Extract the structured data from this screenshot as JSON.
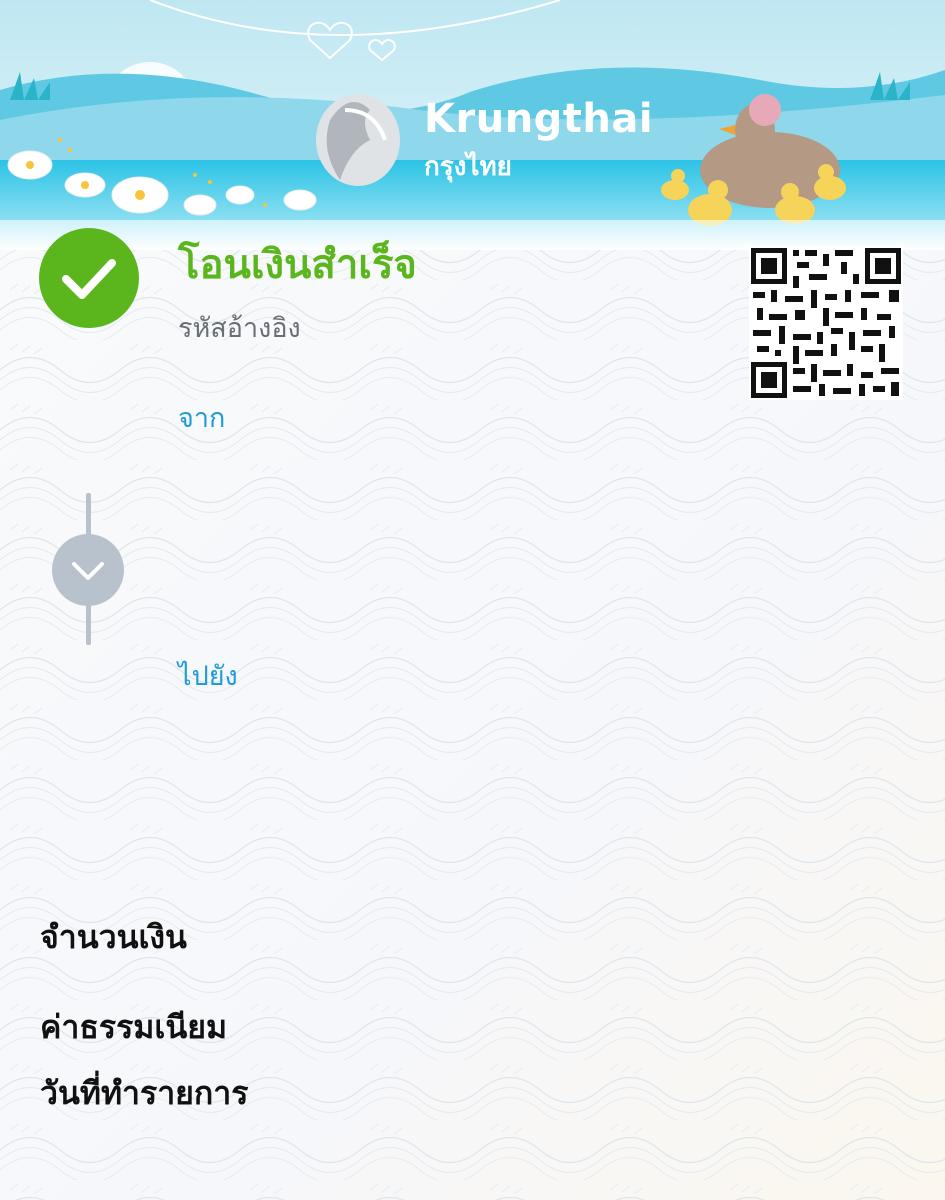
{
  "brand": {
    "name_en": "Krungthai",
    "name_th": "กรุงไทย"
  },
  "status": {
    "title": "โอนเงินสำเร็จ",
    "reference_label": "รหัสอ้างอิง"
  },
  "transfer": {
    "from_label": "จาก",
    "to_label": "ไปยัง"
  },
  "details": {
    "amount_label": "จำนวนเงิน",
    "fee_label": "ค่าธรรมเนียม",
    "date_label": "วันที่ทำรายการ"
  },
  "icons": {
    "success": "check-circle-icon",
    "direction": "chevron-down-icon",
    "qr": "qr-code-icon",
    "logo": "phoenix-logo-icon"
  },
  "colors": {
    "success_green": "#5bb61d",
    "link_blue": "#1f9bd7",
    "sky_blue": "#34c3e6",
    "connector_grey": "#b8c2cd"
  }
}
